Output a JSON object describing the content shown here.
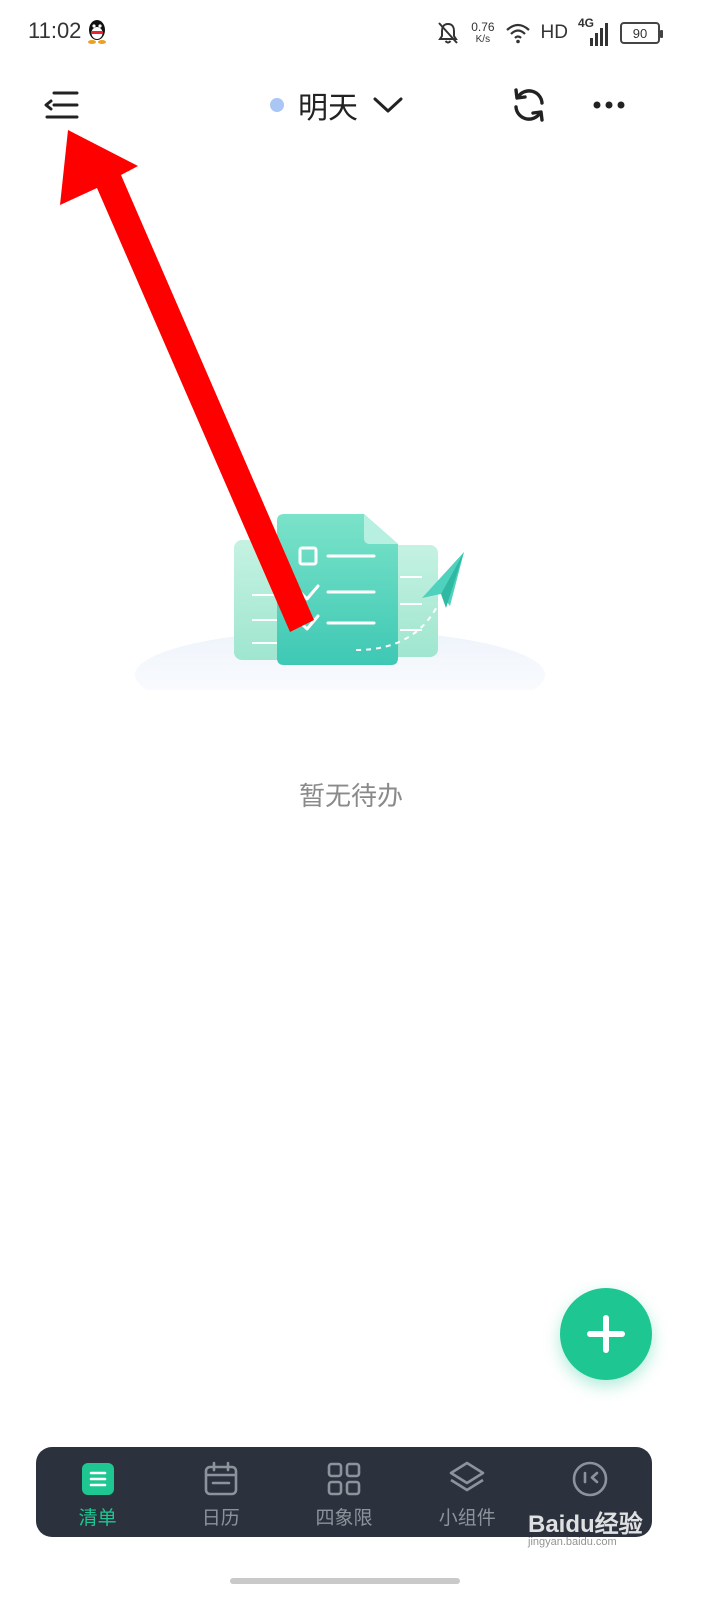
{
  "status_bar": {
    "time": "11:02",
    "net_speed_value": "0.76",
    "net_speed_unit": "K/s",
    "hd": "HD",
    "network": "4G",
    "battery": "90"
  },
  "header": {
    "title": "明天",
    "title_dot_color": "#a9c6f5"
  },
  "empty_state": {
    "text": "暂无待办"
  },
  "bottom_nav": {
    "items": [
      {
        "label": "清单",
        "icon": "list-icon",
        "active": true
      },
      {
        "label": "日历",
        "icon": "calendar-icon",
        "active": false
      },
      {
        "label": "四象限",
        "icon": "grid-icon",
        "active": false
      },
      {
        "label": "小组件",
        "icon": "layers-icon",
        "active": false
      },
      {
        "label": "",
        "icon": "focus-icon",
        "active": false
      }
    ]
  },
  "accent_color": "#1ec691",
  "watermark": {
    "brand": "Baidu经验",
    "url": "jingyan.baidu.com"
  }
}
